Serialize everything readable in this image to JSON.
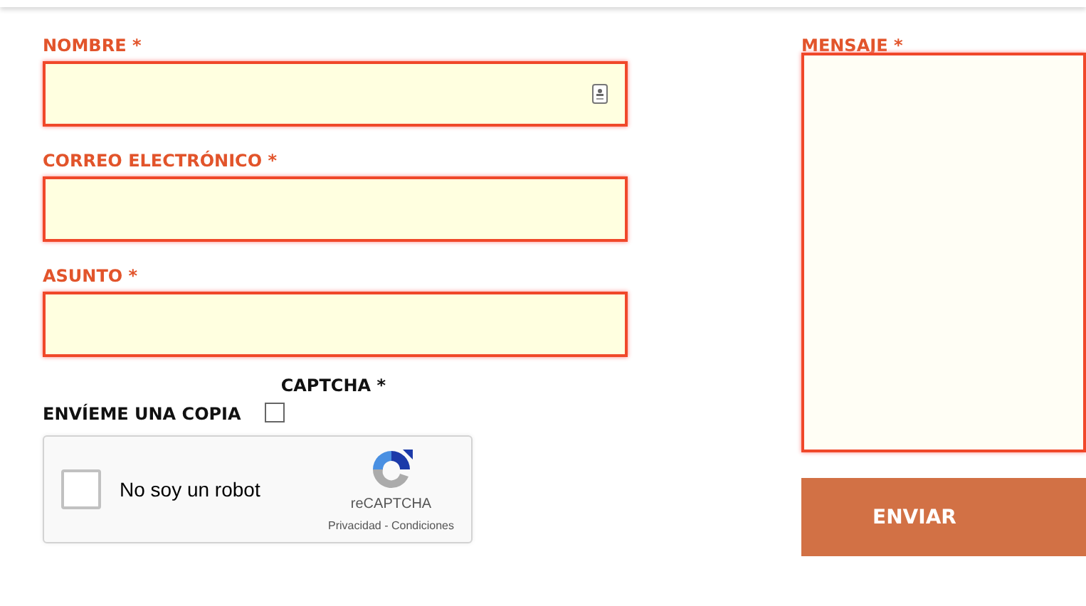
{
  "fields": [
    {
      "label": "NOMBRE *",
      "invalid": true,
      "autofill_icon": true
    },
    {
      "label": "CORREO ELECTRÓNICO *",
      "invalid": true,
      "autofill_icon": false
    },
    {
      "label": "ASUNTO *",
      "invalid": true,
      "autofill_icon": false
    }
  ],
  "copy": {
    "label": "ENVÍEME UNA COPIA",
    "checked": false
  },
  "captcha": {
    "label": "CAPTCHA *",
    "checkbox_label": "No soy un robot",
    "checked": false,
    "brand": "reCAPTCHA",
    "links": "Privacidad - Condiciones"
  },
  "message": {
    "label": "MENSAJE *",
    "invalid": true
  },
  "submit": "ENVIAR"
}
